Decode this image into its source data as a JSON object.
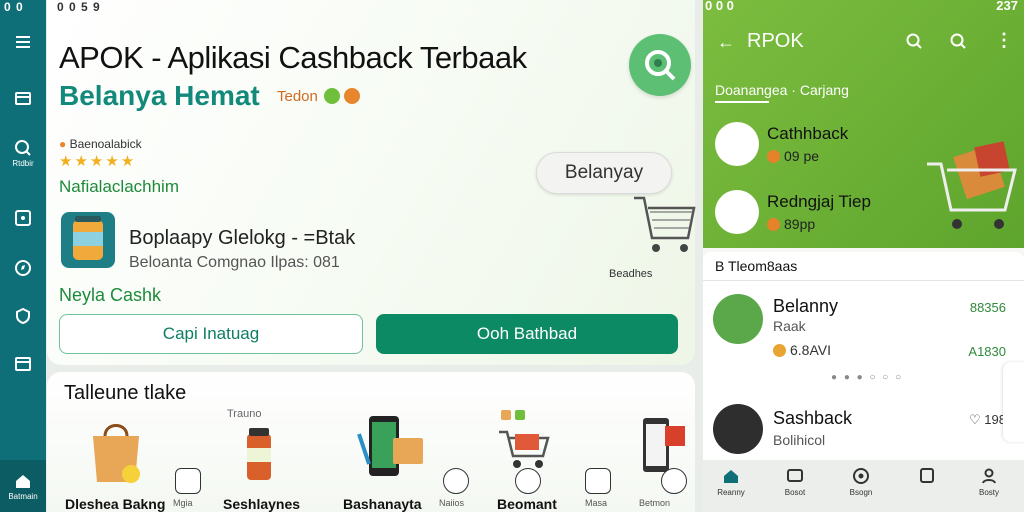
{
  "left_rail": {
    "status": "0 0",
    "items": [
      {
        "label": "",
        "icon": "menu-icon"
      },
      {
        "label": "",
        "icon": "wallet-icon"
      },
      {
        "label": "Rtdbir",
        "icon": "search-icon"
      },
      {
        "label": "",
        "icon": "tag-icon"
      },
      {
        "label": "",
        "icon": "compass-icon"
      },
      {
        "label": "",
        "icon": "heart-shield-icon"
      },
      {
        "label": "",
        "icon": "store-icon"
      },
      {
        "label": "Batmain",
        "icon": "home-icon"
      }
    ]
  },
  "main": {
    "top_status": "0 0 5 9",
    "title": "APOK - Aplikasi Cashback Terbaak",
    "subtitle": "Belanya Hemat",
    "sub_tag": "Tedon",
    "rating_label": "Baenoalabick",
    "stars": "★★★★★",
    "promo_text": "Nafialaclachhim",
    "pill_label": "Belanyay",
    "cart_caption": "Beadhes",
    "product": {
      "title": "Boplaapy Glelokg - =Btak",
      "subtitle": "Beloanta Comgnao Ilpas: 081"
    },
    "cash_text": "Neyla Cashk",
    "btn_outline": "Capi Inatuag",
    "btn_solid": "Ooh Bathbad"
  },
  "bottom": {
    "section_title": "Talleune tlake",
    "tiles": [
      {
        "label": "Dleshea Bakng",
        "top": ""
      },
      {
        "label": "Mgia",
        "top": ""
      },
      {
        "label": "Seshlaynes",
        "top": "Trauno"
      },
      {
        "label": "Bashanayta",
        "top": ""
      },
      {
        "label": "Naiios",
        "top": ""
      },
      {
        "label": "Beomant",
        "top": ""
      },
      {
        "label": "Masa",
        "top": ""
      },
      {
        "label": "Betmon",
        "top": ""
      }
    ]
  },
  "phone": {
    "status_left": "0 0 0",
    "status_right": "237",
    "title": "RPOK",
    "category_tab": "Doanangea · Carjang",
    "highlights": [
      {
        "title": "Cathhback",
        "coin": "09 pe"
      },
      {
        "title": "Redngjaj Tiep",
        "coin": "89pp"
      }
    ],
    "list_head": "B Tleom8aas",
    "rows": [
      {
        "title": "Belanny",
        "sub": "Raak",
        "coin": "6.8AVI",
        "price_top": "88356",
        "price_bottom": "A1830"
      },
      {
        "title": "Sashback",
        "sub": "Bolihicol",
        "coin": "",
        "price_top": "198",
        "price_bottom": ""
      }
    ],
    "pager": "● ● ● ○ ○ ○",
    "tabs": [
      {
        "label": "Reanny",
        "icon": "home-icon"
      },
      {
        "label": "Bosot",
        "icon": "tv-icon"
      },
      {
        "label": "Bsogn",
        "icon": "scan-icon"
      },
      {
        "label": "",
        "icon": "chat-icon"
      },
      {
        "label": "Bosty",
        "icon": "person-icon"
      }
    ]
  },
  "colors": {
    "accent": "#0c8a63",
    "rail": "#0f6f78",
    "phone_header": "#6fb038",
    "subtitle": "#12897a"
  }
}
